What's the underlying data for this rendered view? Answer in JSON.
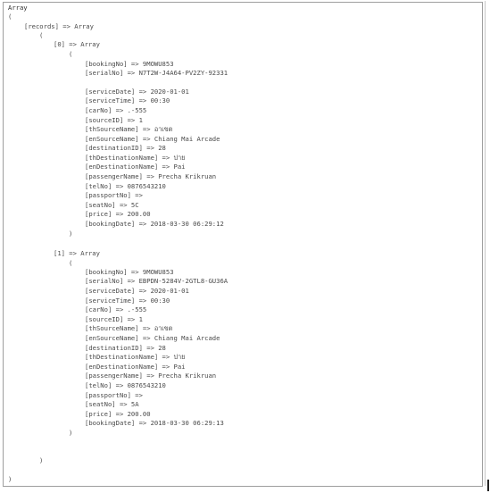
{
  "dump": {
    "root_type": "Array",
    "open_paren": "(",
    "close_paren": ")",
    "records_line": "[records] => Array",
    "records": [
      {
        "index_line": "[0] => Array",
        "fields": [
          "[bookingNo] => 9MOWU853",
          "[serialNo] => N7T2W-J4A64-PV2ZY-92331",
          "[serviceDate] => 2020-01-01",
          "[serviceTime] => 00:30",
          "[carNo] => .-555",
          "[sourceID] => 1",
          "[thSourceName] => อาเขต",
          "[enSourceName] => Chiang Mai Arcade",
          "[destinationID] => 28",
          "[thDestinationName] => ปาย",
          "[enDestinationName] => Pai",
          "[passengerName] => Precha Krikruan",
          "[telNo] => 0876543210",
          "[passportNo] =>",
          "[seatNo] => 5C",
          "[price] => 200.00",
          "[bookingDate] => 2018-03-30 06:29:12"
        ]
      },
      {
        "index_line": "[1] => Array",
        "fields": [
          "[bookingNo] => 9MOWU853",
          "[serialNo] => EBPDN-5284V-2GTL8-GU36A",
          "[serviceDate] => 2020-01-01",
          "[serviceTime] => 00:30",
          "[carNo] => .-555",
          "[sourceID] => 1",
          "[thSourceName] => อาเขต",
          "[enSourceName] => Chiang Mai Arcade",
          "[destinationID] => 28",
          "[thDestinationName] => ปาย",
          "[enDestinationName] => Pai",
          "[passengerName] => Precha Krikruan",
          "[telNo] => 0876543210",
          "[passportNo] =>",
          "[seatNo] => 5A",
          "[price] => 200.00",
          "[bookingDate] => 2018-03-30 06:29:13"
        ]
      }
    ]
  },
  "colors": {
    "text": "#4a4a4a",
    "border": "#9e9e9e",
    "background": "#ffffff"
  }
}
